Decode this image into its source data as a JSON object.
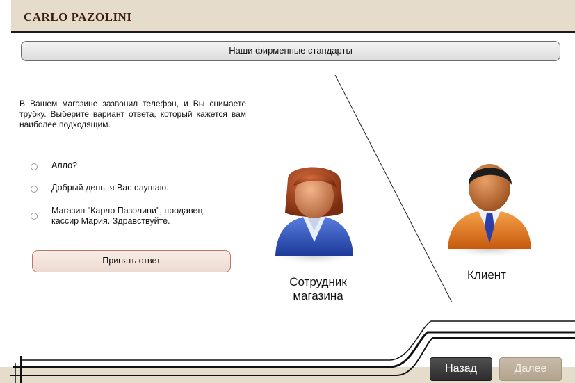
{
  "header": {
    "brand": "CARLO PAZOLINI"
  },
  "section": {
    "title": "Наши фирменные стандарты"
  },
  "question": {
    "text": "В Вашем магазине зазвонил телефон, и Вы снимаете трубку. Выберите вариант ответа, который кажется вам наиболее подходящим."
  },
  "options": [
    {
      "label": "Алло?"
    },
    {
      "label": "Добрый день, я Вас слушаю."
    },
    {
      "label": "Магазин \"Карло Пазолини\", продавец-кассир Мария. Здравствуйте."
    }
  ],
  "accept_button": {
    "label": "Принять ответ"
  },
  "characters": {
    "staff": {
      "label": "Сотрудник магазина",
      "icon": "female-employee-icon"
    },
    "client": {
      "label": "Клиент",
      "icon": "male-client-icon"
    }
  },
  "navigation": {
    "back_label": "Назад",
    "next_label": "Далее"
  },
  "colors": {
    "header_bg": "#e6dccb",
    "brand": "#3a1b0c",
    "accept_border": "#b57a63",
    "staff_suit": "#2f52b8",
    "client_suit": "#e07a1c"
  }
}
